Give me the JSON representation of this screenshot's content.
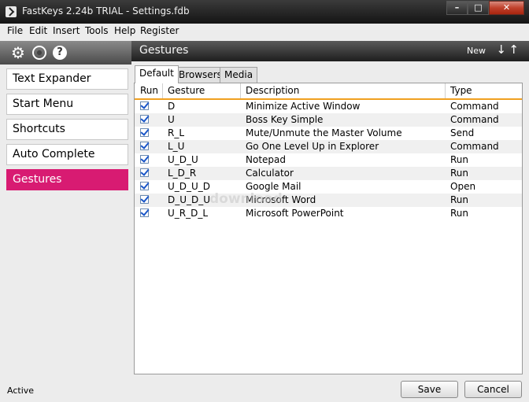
{
  "window": {
    "title": "FastKeys 2.24b TRIAL - Settings.fdb"
  },
  "menubar": {
    "items": [
      "File",
      "Edit",
      "Insert",
      "Tools",
      "Help",
      "Register"
    ]
  },
  "toolbar": {
    "icons": [
      "gear-icon",
      "globe-icon",
      "help-icon"
    ],
    "help_glyph": "?"
  },
  "sidebar": {
    "items": [
      {
        "label": "Text Expander",
        "active": false
      },
      {
        "label": "Start Menu",
        "active": false
      },
      {
        "label": "Shortcuts",
        "active": false
      },
      {
        "label": "Auto Complete",
        "active": false
      },
      {
        "label": "Gestures",
        "active": true
      }
    ],
    "accent_color": "#d81b72"
  },
  "panel": {
    "title": "Gestures",
    "new_label": "New",
    "arrow_down": "↓",
    "arrow_up": "↑"
  },
  "tabs": [
    {
      "label": "Default",
      "selected": true
    },
    {
      "label": "Browsers",
      "selected": false
    },
    {
      "label": "Media",
      "selected": false
    }
  ],
  "table": {
    "columns": [
      "Run",
      "Gesture",
      "Description",
      "Type"
    ],
    "header_accent": "#f0a020",
    "rows": [
      {
        "run": true,
        "gesture": "D",
        "description": "Minimize Active Window",
        "type": "Command"
      },
      {
        "run": true,
        "gesture": "U",
        "description": "Boss Key Simple",
        "type": "Command"
      },
      {
        "run": true,
        "gesture": "R_L",
        "description": "Mute/Unmute the Master Volume",
        "type": "Send"
      },
      {
        "run": true,
        "gesture": "L_U",
        "description": "Go One Level Up in Explorer",
        "type": "Command"
      },
      {
        "run": true,
        "gesture": "U_D_U",
        "description": "Notepad",
        "type": "Run"
      },
      {
        "run": true,
        "gesture": "L_D_R",
        "description": "Calculator",
        "type": "Run"
      },
      {
        "run": true,
        "gesture": "U_D_U_D",
        "description": "Google Mail",
        "type": "Open"
      },
      {
        "run": true,
        "gesture": "D_U_D_U",
        "description": "Microsoft Word",
        "type": "Run"
      },
      {
        "run": true,
        "gesture": "U_R_D_L",
        "description": "Microsoft PowerPoint",
        "type": "Run"
      }
    ]
  },
  "watermark": "download",
  "status": {
    "text": "Active"
  },
  "buttons": {
    "save": "Save",
    "cancel": "Cancel"
  }
}
